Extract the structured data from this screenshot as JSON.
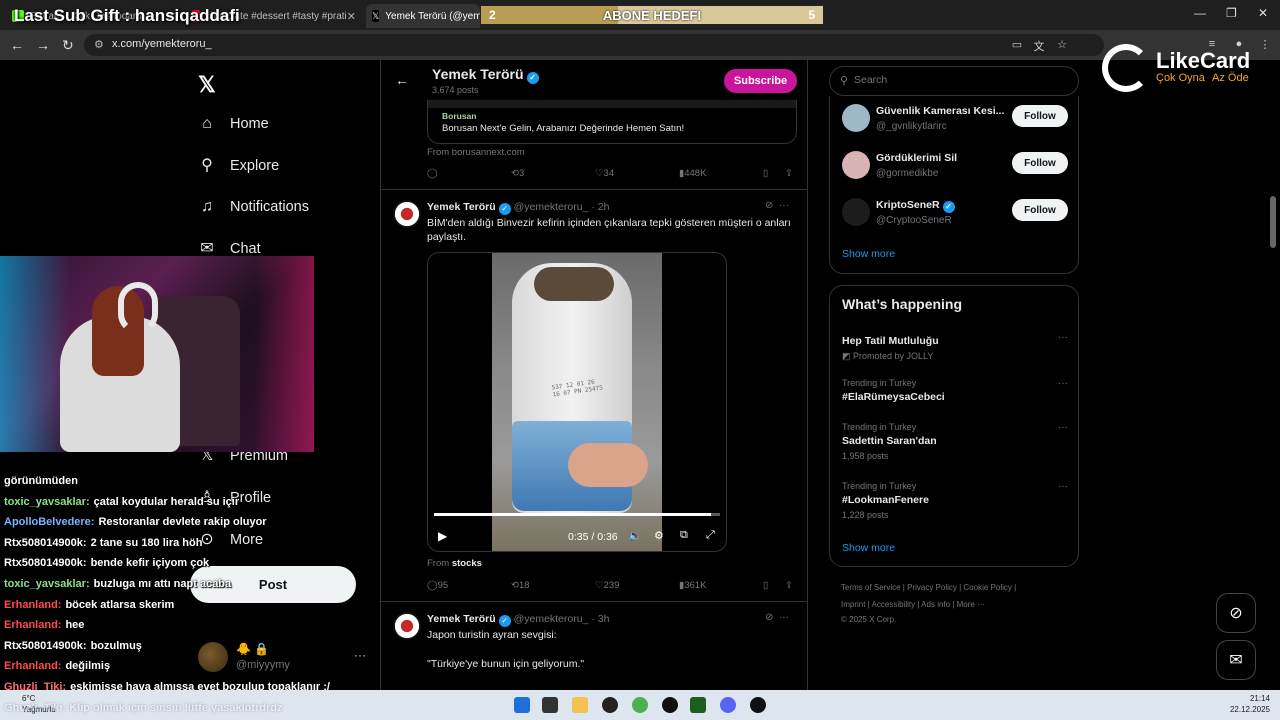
{
  "browser": {
    "tabs": [
      {
        "label": "Stream - Kick Dashboard",
        "active": false
      },
      {
        "label": "chocolate #dessert #tasty #prati",
        "active": false
      },
      {
        "label": "Yemek Terörü (@yemekter",
        "active": true
      }
    ],
    "url": "x.com/yemekteroru_"
  },
  "overlay": {
    "last_sub_gift": "Last Sub Gift : hansiqaddafi",
    "goal_current": "2",
    "goal_label": "ABONE HEDEFI",
    "goal_target": "5",
    "goal_progress": 0.4,
    "likecard_brand": "LikeCard",
    "likecard_slogan_1": "Çok Oyna",
    "likecard_slogan_2": "Az Öde"
  },
  "nav": {
    "items": [
      {
        "label": "Home",
        "icon": "home-icon"
      },
      {
        "label": "Explore",
        "icon": "search-icon"
      },
      {
        "label": "Notifications",
        "icon": "bell-icon"
      },
      {
        "label": "Chat",
        "icon": "mail-icon"
      },
      {
        "label": "Premium",
        "icon": "x-logo-icon"
      },
      {
        "label": "Profile",
        "icon": "person-icon"
      },
      {
        "label": "More",
        "icon": "more-circle-icon"
      }
    ],
    "post_label": "Post",
    "account_handle": "@miyyymy"
  },
  "chat": [
    {
      "user": "",
      "msg": "görünümüden",
      "color": "#ffffff"
    },
    {
      "user": "toxic_yavsaklar:",
      "msg": "çatal koydular herald su içir",
      "color": "#8ee08e"
    },
    {
      "user": "ApolloBelvedere:",
      "msg": "Restoranlar devlete rakip oluyor",
      "color": "#7fb1ff"
    },
    {
      "user": "Rtx508014900k:",
      "msg": "2 tane su 180 lira höh",
      "color": "#ffffff"
    },
    {
      "user": "Rtx508014900k:",
      "msg": "bende kefir içiyom çok",
      "color": "#ffffff"
    },
    {
      "user": "toxic_yavsaklar:",
      "msg": "buzluga mı attı napt acaba",
      "color": "#8ee08e"
    },
    {
      "user": "Erhanland:",
      "msg": "böcek atlarsa skerim",
      "color": "#ff4b4b"
    },
    {
      "user": "Erhanland:",
      "msg": "hee",
      "color": "#ff4b4b"
    },
    {
      "user": "Rtx508014900k:",
      "msg": "bozulmuş",
      "color": "#ffffff"
    },
    {
      "user": "Erhanland:",
      "msg": "değilmiş",
      "color": "#ff4b4b"
    },
    {
      "user": "Ghuzli_Tiki:",
      "msg": "eskimişse hava almışsa evet bozulup topaklanır :/",
      "color": "#ff6b6b"
    }
  ],
  "profile": {
    "name": "Yemek Terörü",
    "posts": "3,674 posts",
    "subscribe_label": "Subscribe"
  },
  "ad_card": {
    "brand": "Borusan",
    "title": "Borusan Next'e Gelin, Arabanızı Değerinde Hemen Satın!",
    "from": "From borusannext.com",
    "replies": "",
    "reposts": "3",
    "likes": "34",
    "views": "448K"
  },
  "tweet1": {
    "name": "Yemek Terörü",
    "handle": "@yemekteroru_ · 2h",
    "text": "BİM'den aldığı Binvezir kefirin içinden çıkanlara tepki gösteren müşteri o anları paylaştı.",
    "video_time": "0:35 / 0:36",
    "video_progress": 0.97,
    "from_prefix": "From",
    "from_source": "stocks",
    "replies": "95",
    "reposts": "18",
    "likes": "239",
    "views": "361K"
  },
  "tweet2": {
    "name": "Yemek Terörü",
    "handle": "@yemekteroru_ · 3h",
    "text": "Japon turistin ayran sevgisi:",
    "quote": "\"Türkiye'ye bunun için geliyorum.\""
  },
  "sidebar": {
    "search_placeholder": "Search",
    "who_to_follow": [
      {
        "name": "Güvenlik Kamerası Kesi...",
        "handle": "@_gvnlikytlarirc",
        "avatar_color": "#9fb8c9"
      },
      {
        "name": "Gördüklerimi Sil",
        "handle": "@gormedikbe",
        "avatar_color": "#d7b3b3"
      },
      {
        "name": "KriptoSeneR",
        "handle": "@CryptooSeneR",
        "avatar_color": "#1b1b1b"
      }
    ],
    "follow_label": "Follow",
    "show_more": "Show more",
    "happening_title": "What’s happening",
    "trends": [
      {
        "kicker": "",
        "title": "Hep Tatil Mutluluğu",
        "count": "Promoted by JOLLY"
      },
      {
        "kicker": "Trending in Turkey",
        "title": "#ElaRümeysaCebeci",
        "count": ""
      },
      {
        "kicker": "Trending in Turkey",
        "title": "Sadettin Saran'dan",
        "count": "1,958 posts"
      },
      {
        "kicker": "Trending in Turkey",
        "title": "#LookmanFenere",
        "count": "1,228 posts"
      }
    ],
    "footer_row1": "Terms of Service  |  Privacy Policy  |  Cookie Policy  |",
    "footer_row2": "Imprint  |  Accessibility  |  Ads info  |  More ···",
    "footer_row3": "© 2025 X Corp."
  },
  "taskbar": {
    "weather_temp": "6°C",
    "weather_desc": "Yağmurlu",
    "time": "21:14",
    "date": "22.12.2025",
    "bottom_chat": "Ghuzli_Tiki: Klip olmak için sinsin lütfe yasaklötrdrdz"
  }
}
